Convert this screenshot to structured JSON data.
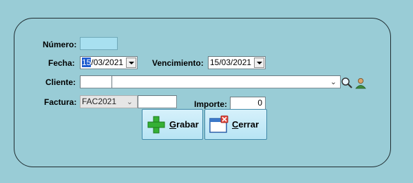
{
  "form": {
    "numero_label": "Número:",
    "numero_value": "",
    "fecha_label": "Fecha:",
    "fecha_day_selected": "15",
    "fecha_rest": "/03/2021",
    "vencimiento_label": "Vencimiento:",
    "vencimiento_value": "15/03/2021",
    "cliente_label": "Cliente:",
    "cliente_code": "",
    "cliente_name": "",
    "factura_label": "Factura:",
    "factura_series": "FAC2021",
    "factura_number": "",
    "importe_label": "Importe:",
    "importe_value": "0"
  },
  "buttons": {
    "grabar_accel": "G",
    "grabar_rest": "rabar",
    "cerrar_accel": "C",
    "cerrar_rest": "errar"
  },
  "icons": {
    "search": "magnifier-icon",
    "client": "person-icon",
    "save": "green-plus-icon",
    "close": "window-close-icon"
  },
  "colors": {
    "background": "#99ccd6",
    "selection": "#1e5bd0",
    "numero_field": "#a8e0f0"
  }
}
